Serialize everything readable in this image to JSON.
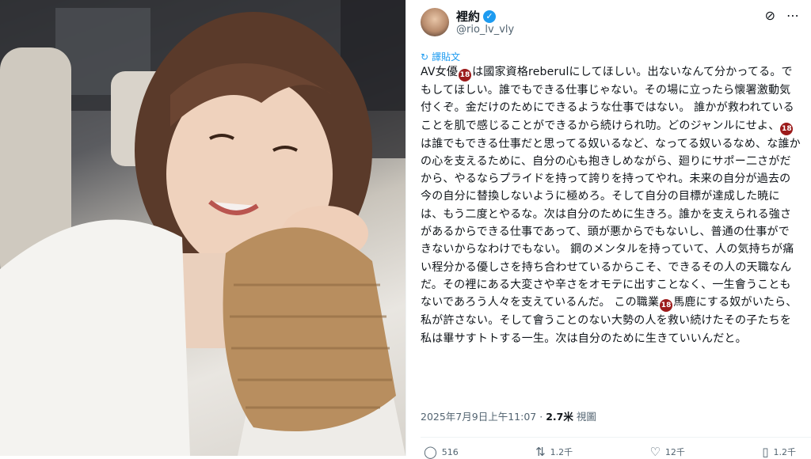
{
  "profile": {
    "name": "裡約",
    "handle": "@rio_lv_vly",
    "verified_icon": "verified-check-icon"
  },
  "icons": {
    "grok": "grok-icon",
    "more": "more-options-icon",
    "translate": "translate-icon"
  },
  "translate_label": "譯貼文",
  "badge": "18",
  "post": {
    "segments": [
      "AV女優",
      "は國家資格reberulにしてほしい。出ないなんて分かってる。でもしてほしい。誰でもできる仕事じゃない。その場に立ったら懐署激動気付くぞ。金だけのためにできるような仕事ではない。 誰かが救われていることを肌で感じることができるから続けられ叻。どのジャンルにせよ、",
      "は誰でもできる仕事だと思ってる奴いるなど、なってる奴いるなめ、な誰かの心を支えるために、自分の心も抱きしめながら、廻りにサポー二さがだから、やるならプライドを持って誇りを持ってやれ。未来の自分が過去の今の自分に替換しないように極めろ。そして自分の目標が達成した暁には、もう二度とやるな。次は自分のために生きろ。誰かを支えられる強さがあるからできる仕事であって、頭が悪からでもないし、普通の仕事ができないからなわけでもない。 鋼のメンタルを持っていて、人の気持ちが痛い程分かる優しさを持ち合わせているからこそ、できるその人の天職なんだ。その裡にある大変さや辛さをオモテに出すことなく、一生會うこともないであろう人々を支えているんだ。 この職業",
      "馬鹿にする奴がいたら、私が許さない。そして會うことのない大勢の人を救い続けたその子たちを私は畢サすトトする一生。次は自分のために生きていいんだと。"
    ]
  },
  "meta": {
    "datetime": "2025年7月9日上午11:07",
    "dot": "·",
    "views_count": "2.7米",
    "views_label": "視圖"
  },
  "actions": [
    {
      "icon": "reply-icon",
      "glyph": "◯",
      "label": "516"
    },
    {
      "icon": "repost-icon",
      "glyph": "⇅",
      "label": "1.2千"
    },
    {
      "icon": "like-icon",
      "glyph": "♡",
      "label": "12千"
    },
    {
      "icon": "bookmark-icon",
      "glyph": "▯",
      "label": "1.2千"
    }
  ]
}
